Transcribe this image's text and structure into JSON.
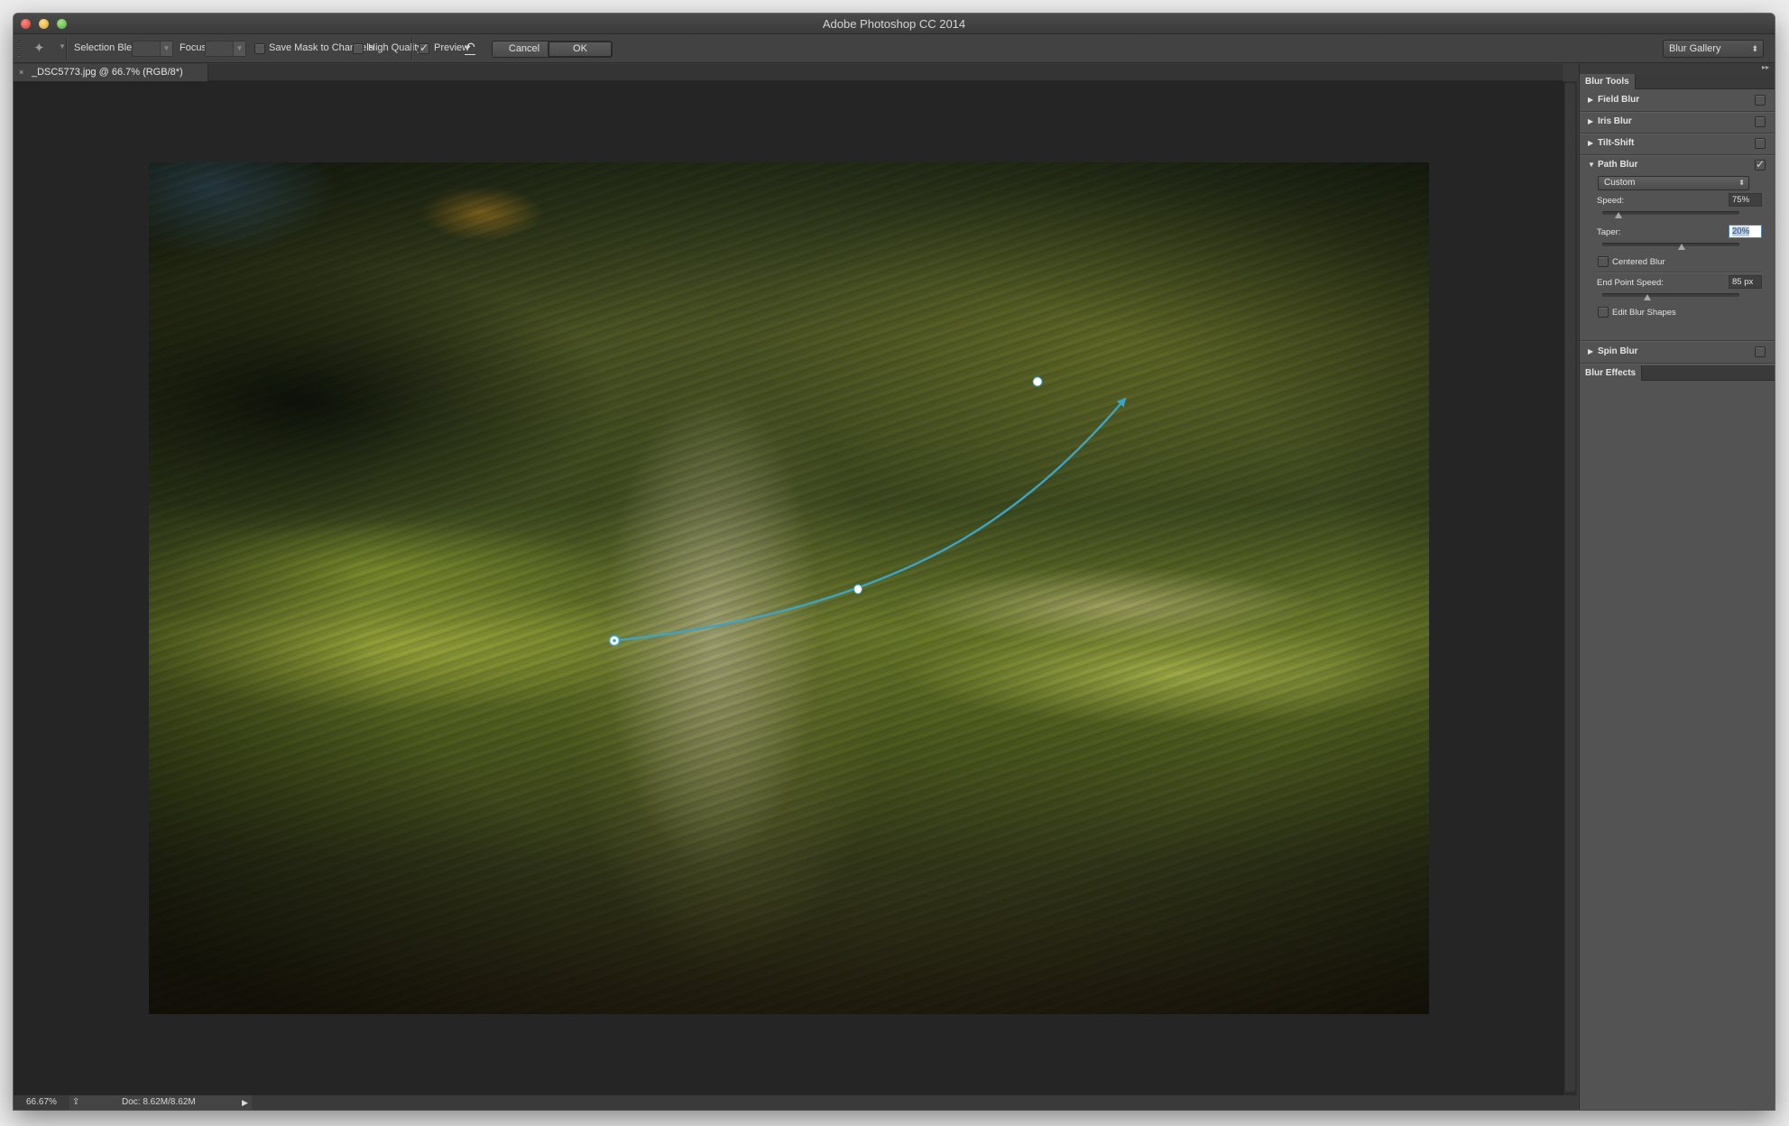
{
  "window": {
    "title": "Adobe Photoshop CC 2014"
  },
  "options_bar": {
    "tool_icon": "pin-icon",
    "selection_bleed_label": "Selection Bleed:",
    "selection_bleed_value": "",
    "focus_label": "Focus:",
    "focus_value": "",
    "save_mask_label": "Save Mask to Channels",
    "save_mask_checked": false,
    "high_quality_label": "High Quality",
    "high_quality_checked": false,
    "preview_label": "Preview",
    "preview_checked": true,
    "reset_icon": "undo-icon",
    "cancel_label": "Cancel",
    "ok_label": "OK",
    "workspace_label": "Blur Gallery"
  },
  "document": {
    "tab_label": "_DSC5773.jpg @ 66.7% (RGB/8*)",
    "close_glyph": "×"
  },
  "status_bar": {
    "zoom": "66.67%",
    "doc_info": "Doc: 8.62M/8.62M"
  },
  "path_blur_overlay": {
    "color": "#3fa3c4",
    "points": [
      "start",
      "mid",
      "end"
    ]
  },
  "panel": {
    "collapse_glyph": "▸▸",
    "blur_tools_tab": "Blur Tools",
    "blur_effects_tab": "Blur Effects",
    "tools": [
      {
        "name": "Field Blur",
        "expanded": false,
        "enabled": false
      },
      {
        "name": "Iris Blur",
        "expanded": false,
        "enabled": false
      },
      {
        "name": "Tilt-Shift",
        "expanded": false,
        "enabled": false
      },
      {
        "name": "Path Blur",
        "expanded": true,
        "enabled": true
      },
      {
        "name": "Spin Blur",
        "expanded": false,
        "enabled": false
      }
    ],
    "path_blur": {
      "preset": "Custom",
      "speed_label": "Speed:",
      "speed_value": "75%",
      "speed_fraction": 0.12,
      "taper_label": "Taper:",
      "taper_value": "20%",
      "taper_fraction": 0.58,
      "centered_blur_label": "Centered Blur",
      "centered_blur_checked": false,
      "end_point_speed_label": "End Point Speed:",
      "end_point_speed_value": "85 px",
      "end_point_speed_fraction": 0.33,
      "edit_blur_shapes_label": "Edit Blur Shapes",
      "edit_blur_shapes_checked": false
    }
  }
}
